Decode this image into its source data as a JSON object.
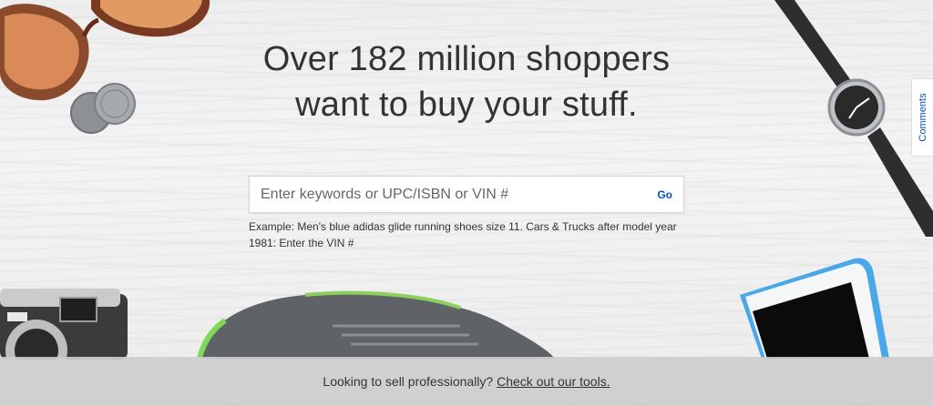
{
  "hero": {
    "line1": "Over 182 million shoppers",
    "line2": "want to buy your stuff."
  },
  "search": {
    "placeholder": "Enter keywords or UPC/ISBN or VIN #",
    "value": "",
    "go_label": "Go",
    "example": "Example: Men's blue adidas glide running shoes size 11. Cars & Trucks after model year 1981: Enter the VIN #"
  },
  "feedback": {
    "label": "Comments"
  },
  "banner": {
    "text": "Looking to sell professionally?",
    "link_label": "Check out our tools."
  },
  "decor": [
    {
      "icon": "sunglasses-icon"
    },
    {
      "icon": "coins-icon"
    },
    {
      "icon": "wristwatch-icon"
    },
    {
      "icon": "camera-icon"
    },
    {
      "icon": "sneaker-icon"
    },
    {
      "icon": "smartphone-icon"
    }
  ]
}
